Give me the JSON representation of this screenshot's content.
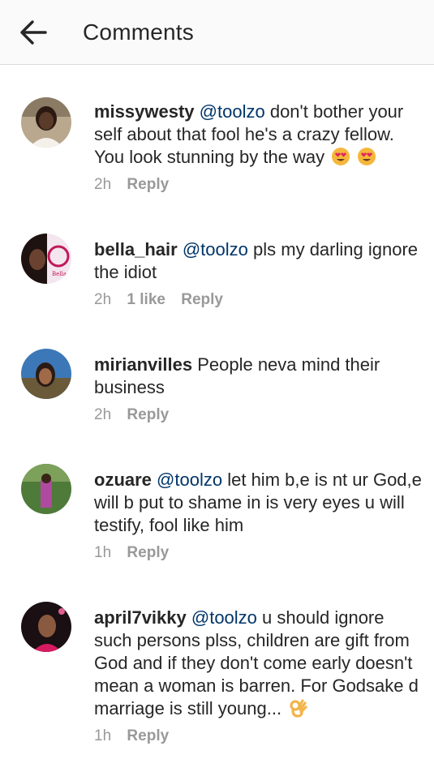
{
  "header": {
    "title": "Comments",
    "back_icon": "arrow-left-icon"
  },
  "colors": {
    "mention": "#003569",
    "meta": "#999999",
    "text": "#262626"
  },
  "comments": [
    {
      "username": "missywesty",
      "mention": "@toolzo",
      "text": "don't bother your self about that fool he's a crazy fellow. You look stunning by the way",
      "emojis": [
        "heart-eyes-emoji",
        "heart-eyes-emoji"
      ],
      "time": "2h",
      "likes": "",
      "reply": "Reply"
    },
    {
      "username": "bella_hair",
      "mention": "@toolzo",
      "text": "pls my darling ignore the idiot",
      "emojis": [],
      "time": "2h",
      "likes": "1 like",
      "reply": "Reply"
    },
    {
      "username": "mirianvilles",
      "mention": "",
      "text": "People neva mind their business",
      "emojis": [],
      "time": "2h",
      "likes": "",
      "reply": "Reply"
    },
    {
      "username": "ozuare",
      "mention": "@toolzo",
      "text": "let him b,e is nt ur God,e will b put to shame in is very eyes u will testify, fool like him",
      "emojis": [],
      "time": "1h",
      "likes": "",
      "reply": "Reply"
    },
    {
      "username": "april7vikky",
      "mention": "@toolzo",
      "text": "u should ignore such persons plss, children are gift from God and if they don't come early doesn't mean a woman is barren. For Godsake d marriage is still young...",
      "emojis": [
        "ok-hand-emoji"
      ],
      "time": "1h",
      "likes": "",
      "reply": "Reply"
    }
  ]
}
